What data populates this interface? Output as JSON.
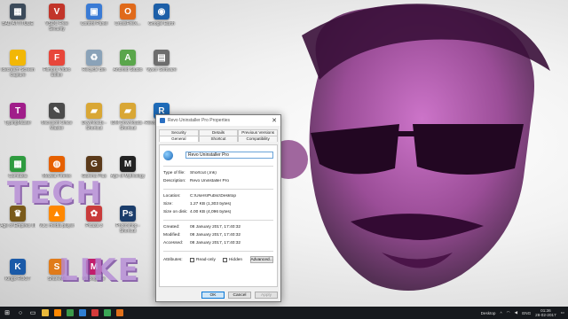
{
  "desktop": {
    "icons": [
      {
        "label": "BAD ATTITUDE",
        "color": "#3b4a5a",
        "glyph": "▦"
      },
      {
        "label": "VSDC Free Security",
        "color": "#c2352a",
        "glyph": "V"
      },
      {
        "label": "Control Panel",
        "color": "#3a7bd5",
        "glyph": "▣"
      },
      {
        "label": "CrossFireX...",
        "color": "#e06a1b",
        "glyph": "O"
      },
      {
        "label": "Google Earth",
        "color": "#1c5fa8",
        "glyph": "◉"
      },
      {
        "label": "Icecream Screen Capture",
        "color": "#f2b705",
        "glyph": "◐"
      },
      {
        "label": "Filmora Video Editor",
        "color": "#e8463a",
        "glyph": "F"
      },
      {
        "label": "Recycle Bin",
        "color": "#8aa2b8",
        "glyph": "♻"
      },
      {
        "label": "Android Studio",
        "color": "#5aa64b",
        "glyph": "A"
      },
      {
        "label": "Vysor Software",
        "color": "#6d6d6d",
        "glyph": "▤"
      },
      {
        "label": "TypingMaster",
        "color": "#a01d8a",
        "glyph": "T"
      },
      {
        "label": "Microsoft Office Master",
        "color": "#4b4b4b",
        "glyph": "✎"
      },
      {
        "label": "Downloads - Shortcut",
        "color": "#d9a735",
        "glyph": "▰"
      },
      {
        "label": "IDM Downloads - Shortcut",
        "color": "#d9a735",
        "glyph": "▰"
      },
      {
        "label": "Revo Uninstaller Pro",
        "color": "#1e6bb8",
        "glyph": "R"
      },
      {
        "label": "Camtasia",
        "color": "#2e9b3f",
        "glyph": "▦"
      },
      {
        "label": "Mozilla Firefox",
        "color": "#e66000",
        "glyph": "◍"
      },
      {
        "label": "Garena Plus",
        "color": "#5b3a1a",
        "glyph": "G"
      },
      {
        "label": "Age of Mythology",
        "color": "#222222",
        "glyph": "M"
      },
      {
        "label": "Age of Empires III",
        "color": "#7a5a1a",
        "glyph": "♛"
      },
      {
        "label": "VLC media player",
        "color": "#ff8800",
        "glyph": "▲"
      },
      {
        "label": "Picasa 3",
        "color": "#c93b3b",
        "glyph": "✿"
      },
      {
        "label": "Photoshop - Shortcut",
        "color": "#1b3d6b",
        "glyph": "Ps"
      },
      {
        "label": "Kingo ROOT",
        "color": "#1a5aa8",
        "glyph": "K"
      },
      {
        "label": "ShareMe",
        "color": "#e07b1a",
        "glyph": "S"
      },
      {
        "label": "Mobogenie",
        "color": "#c21d6b",
        "glyph": "M"
      }
    ],
    "watermark_top": "TECH",
    "watermark_bottom": "LIKE"
  },
  "dialog": {
    "title": "Revo Uninstaller Pro Properties",
    "close_glyph": "✕",
    "tabs_row1": [
      "Security",
      "Details",
      "Previous Versions"
    ],
    "tabs_row2": [
      "General",
      "Shortcut",
      "Compatibility"
    ],
    "active_tab": "General",
    "name_value": "Revo Uninstaller Pro",
    "fields_a": [
      {
        "key": "Type of file:",
        "value": "Shortcut (.lnk)"
      },
      {
        "key": "Description:",
        "value": "Revo Uninstaller Pro"
      }
    ],
    "fields_b": [
      {
        "key": "Location:",
        "value": "C:\\Users\\Public\\Desktop"
      },
      {
        "key": "Size:",
        "value": "1.27 KB (1,303 bytes)"
      },
      {
        "key": "Size on disk:",
        "value": "4.00 KB (4,096 bytes)"
      }
    ],
    "fields_c": [
      {
        "key": "Created:",
        "value": "08 January 2017, 17:40:32"
      },
      {
        "key": "Modified:",
        "value": "08 January 2017, 17:40:32"
      },
      {
        "key": "Accessed:",
        "value": "08 January 2017, 17:40:32"
      }
    ],
    "attributes_label": "Attributes:",
    "readonly_label": "Read-only",
    "hidden_label": "Hidden",
    "advanced_label": "Advanced...",
    "ok_label": "OK",
    "cancel_label": "Cancel",
    "apply_label": "Apply"
  },
  "taskbar": {
    "start_glyph": "⊞",
    "search_glyph": "○",
    "taskview_glyph": "▭",
    "apps": [
      {
        "name": "file-explorer",
        "color": "#e8b83a"
      },
      {
        "name": "vlc",
        "color": "#ff8800"
      },
      {
        "name": "chrome",
        "color": "#3c9a4a"
      },
      {
        "name": "app-blue",
        "color": "#2f7fd3"
      },
      {
        "name": "app-red",
        "color": "#d33b3b"
      },
      {
        "name": "app-green",
        "color": "#3aa655"
      },
      {
        "name": "app-orange",
        "color": "#e0701a"
      }
    ],
    "desktop_label": "Desktop",
    "language": "ENG",
    "time": "01:36",
    "date": "28-02-2017"
  }
}
